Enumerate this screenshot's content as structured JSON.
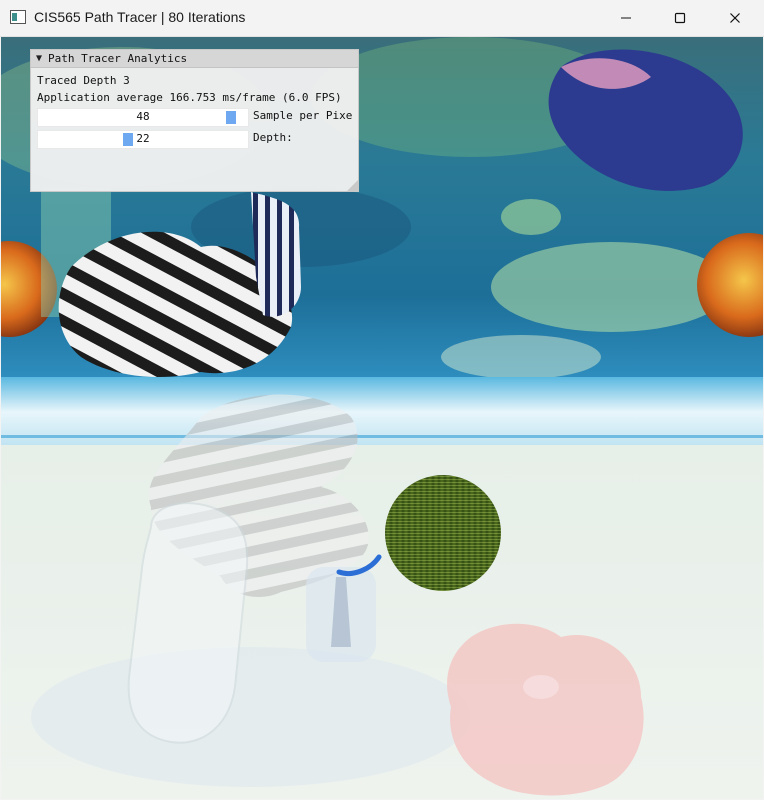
{
  "window": {
    "title": "CIS565 Path Tracer | 80 Iterations",
    "controls": [
      "minimize-icon",
      "maximize-icon",
      "close-icon"
    ]
  },
  "panel": {
    "title": "Path Tracer Analytics",
    "collapse_glyph": "▼",
    "traced_depth": "Traced Depth 3",
    "app_average": "Application average 166.753 ms/frame (6.0 FPS)",
    "samples_slider": {
      "value": "48",
      "label": "Sample per Pixe",
      "fill_fraction": 0.95
    },
    "depth_slider": {
      "value": "22",
      "label": "Depth:",
      "fill_fraction": 0.43
    }
  }
}
